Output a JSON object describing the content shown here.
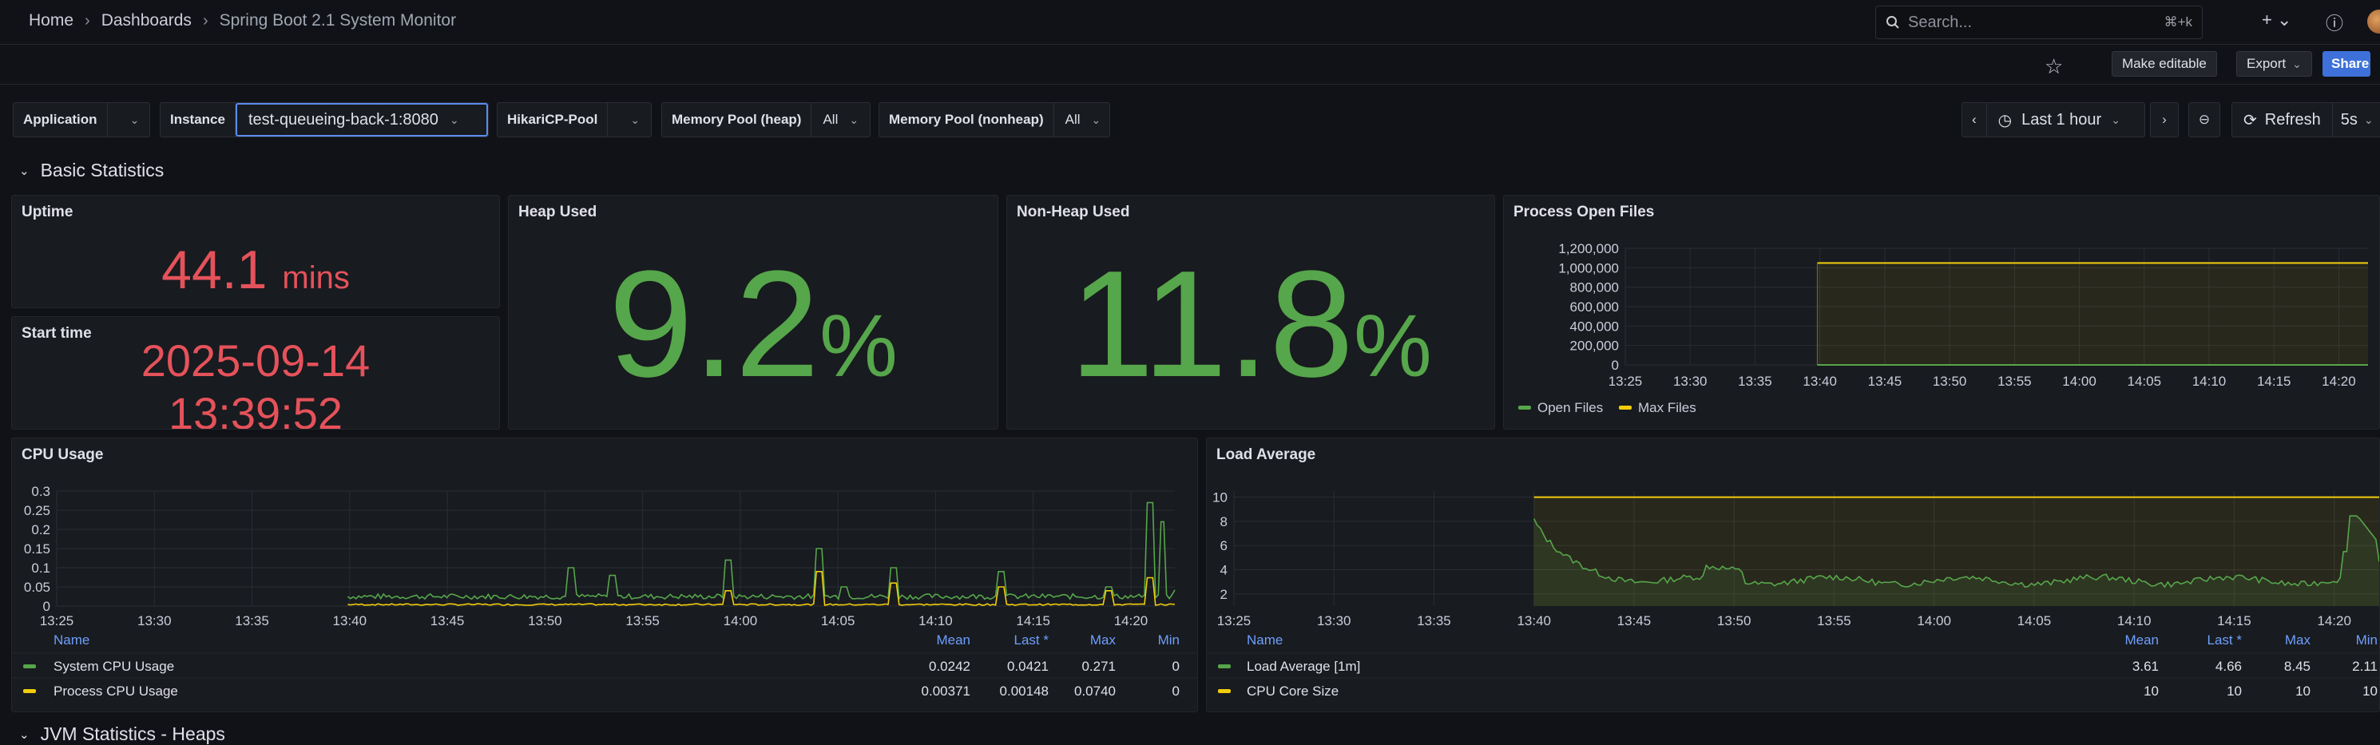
{
  "breadcrumb": {
    "home": "Home",
    "dashboards": "Dashboards",
    "current": "Spring Boot 2.1 System Monitor"
  },
  "search": {
    "placeholder": "Search...",
    "shortcut": "⌘+k"
  },
  "toolbar": {
    "make_editable": "Make editable",
    "export": "Export",
    "share": "Share"
  },
  "variables": [
    {
      "label": "Application",
      "value": ""
    },
    {
      "label": "Instance",
      "value": "test-queueing-back-1:8080"
    },
    {
      "label": "HikariCP-Pool",
      "value": ""
    },
    {
      "label": "Memory Pool (heap)",
      "value": "All"
    },
    {
      "label": "Memory Pool (nonheap)",
      "value": "All"
    }
  ],
  "time": {
    "range": "Last 1 hour",
    "refresh": "Refresh",
    "interval": "5s"
  },
  "rows": {
    "basic": "Basic Statistics",
    "jvm": "JVM Statistics - Heaps"
  },
  "colors": {
    "green": "#56a64b",
    "yellow": "#f2cc0c",
    "red": "#e5525b",
    "accent": "#3d71d9"
  },
  "panels": {
    "uptime": {
      "title": "Uptime",
      "value": "44.1",
      "unit": "mins"
    },
    "start_time": {
      "title": "Start time",
      "date": "2025-09-14",
      "time": "13:39:52"
    },
    "heap": {
      "title": "Heap Used",
      "value": "9.2",
      "unit": "%"
    },
    "nonheap": {
      "title": "Non-Heap Used",
      "value": "11.8",
      "unit": "%"
    },
    "open_files": {
      "title": "Process Open Files"
    },
    "cpu": {
      "title": "CPU Usage"
    },
    "load": {
      "title": "Load Average"
    }
  },
  "legend_headers": {
    "name": "Name",
    "mean": "Mean",
    "last": "Last *",
    "max": "Max",
    "min": "Min"
  },
  "chart_data": [
    {
      "id": "open_files",
      "type": "line",
      "title": "Process Open Files",
      "x_ticks": [
        "13:25",
        "13:30",
        "13:35",
        "13:40",
        "13:45",
        "13:50",
        "13:55",
        "14:00",
        "14:05",
        "14:10",
        "14:15",
        "14:20"
      ],
      "y_ticks": [
        "1,200,000",
        "1,000,000",
        "800,000",
        "600,000",
        "400,000",
        "200,000",
        "0"
      ],
      "ylim": [
        0,
        1200000
      ],
      "series": [
        {
          "name": "Open Files",
          "color": "#56a64b",
          "value": 0
        },
        {
          "name": "Max Files",
          "color": "#f2cc0c",
          "value": 1048576
        }
      ],
      "legend": "bottom"
    },
    {
      "id": "cpu",
      "type": "line",
      "title": "CPU Usage",
      "x_ticks": [
        "13:25",
        "13:30",
        "13:35",
        "13:40",
        "13:45",
        "13:50",
        "13:55",
        "14:00",
        "14:05",
        "14:10",
        "14:15",
        "14:20"
      ],
      "y_ticks": [
        "0.3",
        "0.25",
        "0.2",
        "0.15",
        "0.1",
        "0.05",
        "0"
      ],
      "ylim": [
        0,
        0.3
      ],
      "series": [
        {
          "name": "System CPU Usage",
          "color": "#56a64b",
          "mean": "0.0242",
          "last": "0.0421",
          "max": "0.271",
          "min": "0"
        },
        {
          "name": "Process CPU Usage",
          "color": "#f2cc0c",
          "mean": "0.00371",
          "last": "0.00148",
          "max": "0.0740",
          "min": "0"
        }
      ]
    },
    {
      "id": "load",
      "type": "line",
      "title": "Load Average",
      "x_ticks": [
        "13:25",
        "13:30",
        "13:35",
        "13:40",
        "13:45",
        "13:50",
        "13:55",
        "14:00",
        "14:05",
        "14:10",
        "14:15",
        "14:20"
      ],
      "y_ticks": [
        "10",
        "8",
        "6",
        "4",
        "2"
      ],
      "ylim": [
        1,
        10.5
      ],
      "series": [
        {
          "name": "Load Average [1m]",
          "color": "#56a64b",
          "mean": "3.61",
          "last": "4.66",
          "max": "8.45",
          "min": "2.11"
        },
        {
          "name": "CPU Core Size",
          "color": "#f2cc0c",
          "mean": "10",
          "last": "10",
          "max": "10",
          "min": "10"
        }
      ]
    }
  ]
}
